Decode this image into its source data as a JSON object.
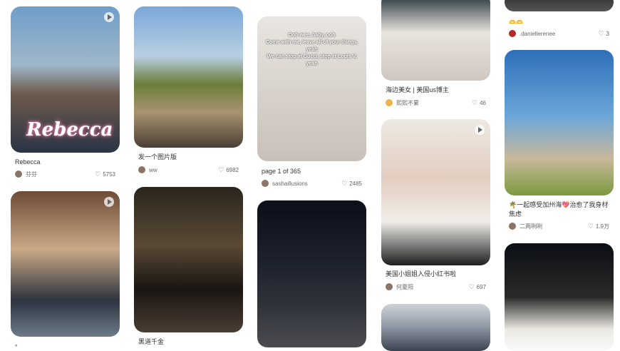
{
  "cards": {
    "c1": {
      "title": "Rebecca",
      "author": "芬芬",
      "likes": "5753",
      "watermark": "Rebecca"
    },
    "c2": {
      "title": "发一个图片版",
      "author": "ww",
      "likes": "6982"
    },
    "c3": {
      "title": "page 1 of 365",
      "author": "sashaillusions",
      "likes": "2485",
      "overlay": "Ooh-wee, baby, ooh\nCome with me, leave all of your things, yeah\nWe can stop at Gucci, stop at Louis V, yeah"
    },
    "c4": {
      "title": "海边美女 | 美国us博主",
      "author": "熙熙不累",
      "likes": "46"
    },
    "c5": {
      "author": ".daniellerenee",
      "likes": "3"
    },
    "c6": {
      "title": "🌴一起感受加州海💖治愈了我身材焦虑",
      "author": "二两咧咧",
      "likes": "1.9万"
    },
    "c7": {
      "title": "美国小姐姐入侵小红书啦",
      "author": "何夏阳",
      "likes": "697"
    },
    "c8": {
      "title": "黑道千金"
    },
    "c9": {
      "title": "。"
    }
  },
  "icons": {
    "like": "heart-icon",
    "play": "play-icon"
  }
}
